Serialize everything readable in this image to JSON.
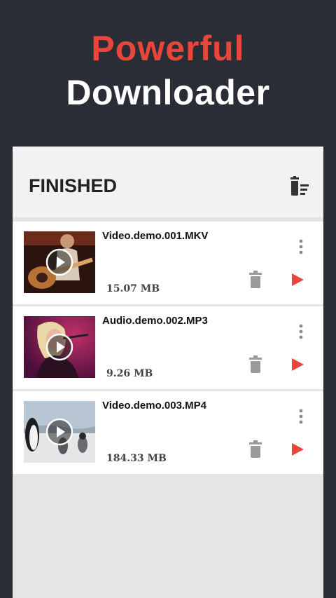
{
  "hero": {
    "line1": "Powerful",
    "line2": "Downloader"
  },
  "panel": {
    "title": "FINISHED",
    "clear_icon": "trash-list-icon"
  },
  "items": [
    {
      "name": "Video.demo.001.MKV",
      "size": "15.07 MB",
      "thumb": "guitarist"
    },
    {
      "name": "Audio.demo.002.MP3",
      "size": "9.26 MB",
      "thumb": "singer"
    },
    {
      "name": "Video.demo.003.MP4",
      "size": "184.33 MB",
      "thumb": "penguins"
    }
  ],
  "icons": {
    "more": "more-vertical-icon",
    "delete": "trash-icon",
    "play": "play-icon"
  },
  "colors": {
    "accent": "#e8463a",
    "background": "#2a2d35",
    "panel": "#e6e4e5"
  }
}
